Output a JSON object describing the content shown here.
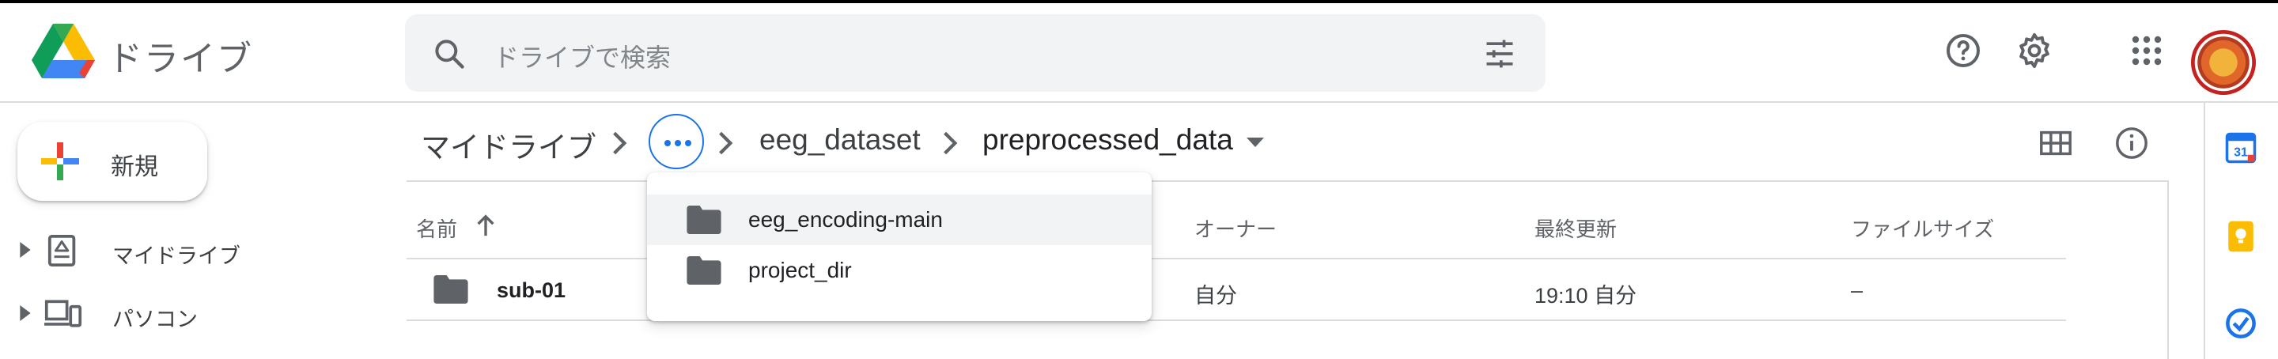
{
  "header": {
    "app_title": "ドライブ",
    "search_placeholder": "ドライブで検索",
    "icons": [
      "drive-logo",
      "search-icon",
      "tune-icon",
      "help-icon",
      "gear-icon",
      "apps-grid-icon",
      "avatar"
    ]
  },
  "sidebar": {
    "new_label": "新規",
    "items": [
      {
        "label": "マイドライブ",
        "icon": "drive-folder-icon"
      },
      {
        "label": "パソコン",
        "icon": "computer-icon"
      }
    ]
  },
  "breadcrumb": {
    "root": "マイドライブ",
    "middle": "eeg_dataset",
    "current": "preprocessed_data"
  },
  "dropdown": {
    "items": [
      {
        "label": "eeg_encoding-main",
        "highlighted": true
      },
      {
        "label": "project_dir",
        "highlighted": false
      }
    ]
  },
  "table": {
    "columns": {
      "name": "名前",
      "owner": "オーナー",
      "modified": "最終更新",
      "size": "ファイルサイズ"
    },
    "rows": [
      {
        "name": "sub-01",
        "owner": "自分",
        "modified": "19:10 自分",
        "size": "–"
      }
    ]
  },
  "colors": {
    "accent": "#1a73e8",
    "icon_gray": "#5f6368",
    "folder_gray": "#5f6368",
    "divider": "#dadce0"
  }
}
